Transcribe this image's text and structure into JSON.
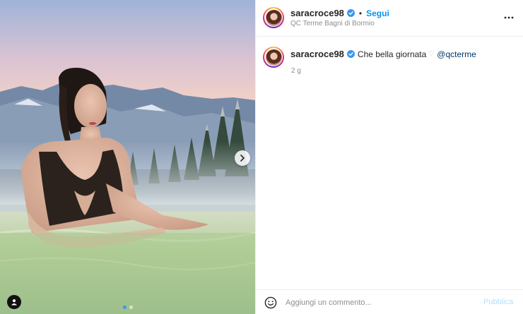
{
  "post": {
    "username": "saracroce98",
    "separator": "•",
    "follow_label": "Segui",
    "location": "QC Terme Bagni di Bormio",
    "verified": true,
    "caption_text": "Che bella giornata",
    "caption_heart": "♡",
    "caption_mention": "@qcterme",
    "time_ago": "2 g",
    "comment_placeholder": "Aggiungi un commento...",
    "publish_label": "Pubblica"
  },
  "carousel": {
    "current_index": 1,
    "total": 2
  },
  "icons": {
    "more": "more-horizontal-icon",
    "verified": "verified-badge-icon",
    "next": "chevron-right-icon",
    "user_tag": "user-tag-icon",
    "emoji": "emoji-icon"
  },
  "colors": {
    "accent": "#0095f6",
    "verified": "#3897f0",
    "mention": "#00376b",
    "muted": "#8e8e8e",
    "publish_disabled": "#b2dffc"
  }
}
